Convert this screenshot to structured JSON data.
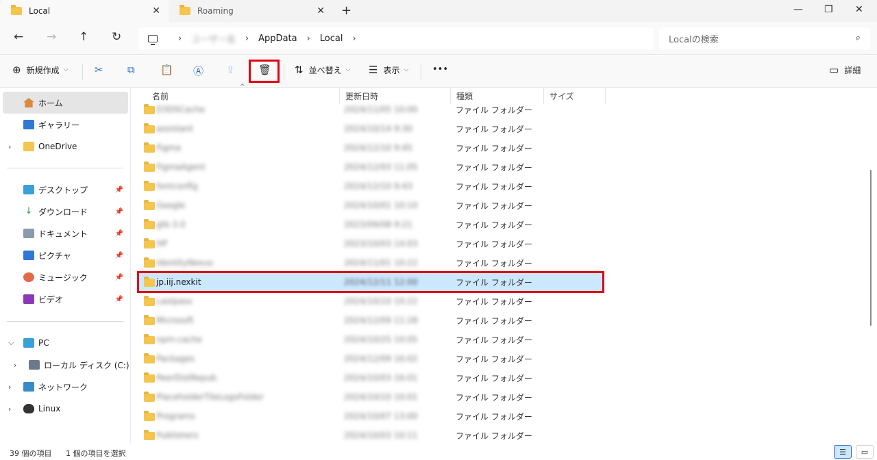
{
  "tabs": [
    {
      "label": "Local",
      "active": true
    },
    {
      "label": "Roaming",
      "active": false
    }
  ],
  "nav": {
    "breadcrumb": [
      "ユーザー名",
      "AppData",
      "Local"
    ],
    "search_placeholder": "Localの検索"
  },
  "commands": {
    "new": "新規作成",
    "sort": "並べ替え",
    "view": "表示",
    "more": "•••",
    "details": "詳細"
  },
  "sidebar": {
    "items": [
      {
        "label": "ホーム",
        "icon": "home-icon"
      },
      {
        "label": "ギャラリー",
        "icon": "gallery-icon"
      },
      {
        "label": "OneDrive",
        "icon": "folder-icon"
      },
      {
        "label": "デスクトップ",
        "icon": "desktop-icon"
      },
      {
        "label": "ダウンロード",
        "icon": "download-icon"
      },
      {
        "label": "ドキュメント",
        "icon": "document-icon"
      },
      {
        "label": "ピクチャ",
        "icon": "pictures-icon"
      },
      {
        "label": "ミュージック",
        "icon": "music-icon"
      },
      {
        "label": "ビデオ",
        "icon": "video-icon"
      },
      {
        "label": "PC",
        "icon": "pc-icon"
      },
      {
        "label": "ローカル ディスク (C:)",
        "icon": "disk-icon"
      },
      {
        "label": "ネットワーク",
        "icon": "network-icon"
      },
      {
        "label": "Linux",
        "icon": "linux-icon"
      }
    ]
  },
  "columns": [
    "名前",
    "更新日時",
    "種類",
    "サイズ"
  ],
  "rows": [
    {
      "name": "D3DSCache",
      "date": "2024/11/05 10:00",
      "type": "ファイル フォルダー"
    },
    {
      "name": "assistant",
      "date": "2024/10/14 9:30",
      "type": "ファイル フォルダー"
    },
    {
      "name": "Figma",
      "date": "2024/12/10 9:45",
      "type": "ファイル フォルダー"
    },
    {
      "name": "FigmaAgent",
      "date": "2024/12/03 11:05",
      "type": "ファイル フォルダー"
    },
    {
      "name": "fontconfig",
      "date": "2024/12/10 9:43",
      "type": "ファイル フォルダー"
    },
    {
      "name": "Google",
      "date": "2024/10/01 10:10",
      "type": "ファイル フォルダー"
    },
    {
      "name": "gtk-3.0",
      "date": "2023/09/08 9:21",
      "type": "ファイル フォルダー"
    },
    {
      "name": "HP",
      "date": "2023/10/03 14:03",
      "type": "ファイル フォルダー"
    },
    {
      "name": "IdentityNexus",
      "date": "2024/11/01 10:22",
      "type": "ファイル フォルダー"
    },
    {
      "name": "jp.iij.nexkit",
      "date": "2024/12/11 12:00",
      "type": "ファイル フォルダー"
    },
    {
      "name": "Lastpass",
      "date": "2024/10/10 10:22",
      "type": "ファイル フォルダー"
    },
    {
      "name": "Microsoft",
      "date": "2024/12/09 11:28",
      "type": "ファイル フォルダー"
    },
    {
      "name": "npm-cache",
      "date": "2024/10/25 10:05",
      "type": "ファイル フォルダー"
    },
    {
      "name": "Packages",
      "date": "2024/12/09 16:02",
      "type": "ファイル フォルダー"
    },
    {
      "name": "PeerDistRepub",
      "date": "2024/10/03 16:01",
      "type": "ファイル フォルダー"
    },
    {
      "name": "PlaceholderTileLogoFolder",
      "date": "2024/10/10 10:01",
      "type": "ファイル フォルダー"
    },
    {
      "name": "Programs",
      "date": "2024/10/07 13:00",
      "type": "ファイル フォルダー"
    },
    {
      "name": "Publishers",
      "date": "2024/10/03 10:11",
      "type": "ファイル フォルダー"
    }
  ],
  "selected_index": 9,
  "status": {
    "count": "39 個の項目",
    "selected": "1 個の項目を選択"
  },
  "colors": {
    "selection": "#cce8ff",
    "highlight_box": "#e00012",
    "folder": "#f4c64e"
  }
}
